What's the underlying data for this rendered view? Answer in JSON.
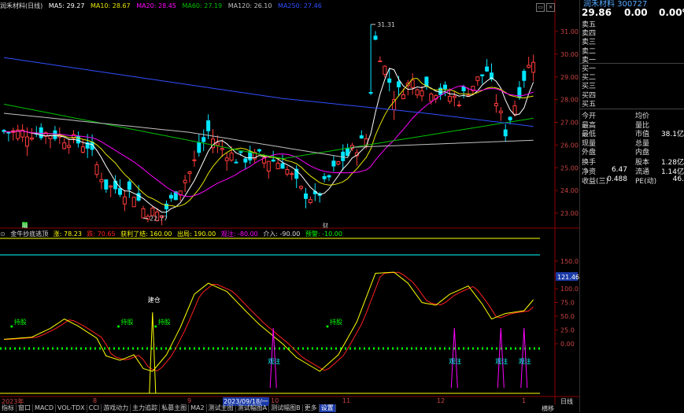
{
  "top_legend": {
    "stock": "润禾材料(日线)",
    "ma5": "MA5: 29.27",
    "ma10": "MA10: 28.67",
    "ma20": "MA20: 28.45",
    "ma60": "MA60: 27.19",
    "ma120": "MA120: 26.10",
    "ma250": "MA250: 27.46"
  },
  "price_axis": [
    "31.00",
    "30.00",
    "29.00",
    "28.00",
    "27.00",
    "26.00",
    "25.00",
    "24.00",
    "23.00"
  ],
  "price_annotations": {
    "high": "31.31",
    "low": "22.77"
  },
  "event_marks": {
    "mark1": "融",
    "mark2": "财"
  },
  "indicator_header": {
    "name": "金牛抄底逃顶",
    "zhang": "涨: 78.23",
    "die": "跌: 70.65",
    "profit": "获利了结: 160.00",
    "exit": "出局: 190.00",
    "observe": "观注: -80.00",
    "buy": "介入: -90.00",
    "watch": "预警: -10.00"
  },
  "indicator_axis": [
    "150.0",
    "125.0",
    "100.0",
    "75.0",
    "50.0",
    "25.0",
    "0.00"
  ],
  "indicator_value_badge": "121.46",
  "indicator_labels": {
    "hold1": "持股",
    "hold2": "持股",
    "hold3": "持股",
    "hold4": "持股",
    "build": "建仓",
    "note1": "观注",
    "note2": "观注",
    "note3": "观注",
    "note4": "观注"
  },
  "time_axis": [
    "2023年",
    "8",
    "9",
    "2023/09/18/一",
    "10",
    "11",
    "12",
    "1"
  ],
  "right_bottom": {
    "mode": "日线",
    "mode2": "横移"
  },
  "bottom_tabs": [
    "指标",
    "窗口",
    "MACD",
    "VOL-TDX",
    "CCI",
    "游戏动力",
    "主力追踪",
    "私募主图",
    "MA2",
    "测试主图",
    "测试幅图A",
    "测试幅图B",
    "更多",
    "设置"
  ],
  "quote": {
    "title": "润禾材料 300727",
    "price": "29.86",
    "change": "0.00",
    "change_pct": "0.00%",
    "order_labels": [
      "卖五",
      "卖四",
      "卖三",
      "卖二",
      "卖一",
      "买一",
      "买二",
      "买三",
      "买四",
      "买五"
    ],
    "stats": [
      {
        "l1": "今开",
        "v1": "",
        "l2": "均价",
        "v2": ""
      },
      {
        "l1": "最高",
        "v1": "",
        "l2": "量比",
        "v2": ""
      },
      {
        "l1": "最低",
        "v1": "",
        "l2": "市值",
        "v2": "38.1亿"
      },
      {
        "l1": "现量",
        "v1": "",
        "l2": "总量",
        "v2": ""
      },
      {
        "l1": "外盘",
        "v1": "",
        "l2": "内盘",
        "v2": ""
      },
      {
        "l1": "换手",
        "v1": "",
        "l2": "股本",
        "v2": "1.28亿"
      },
      {
        "l1": "净资",
        "v1": "6.47",
        "l2": "流通",
        "v2": "1.14亿"
      },
      {
        "l1": "收益(三)",
        "v1": "0.488",
        "l2": "PE(动)",
        "v2": "46."
      }
    ]
  },
  "colors": {
    "up": "#ff3b3b",
    "down": "#00e5ff",
    "ma5": "#ffffff",
    "ma10": "#e6e600",
    "ma20": "#ff00ff",
    "ma60": "#00c000",
    "ma120": "#c0c0c0",
    "ma250": "#2f4fff",
    "ind_yellow": "#ffff00",
    "ind_red": "#ff2020",
    "ind_green": "#00ff00",
    "ind_magenta": "#ff00ff",
    "ind_cyan": "#00ffff"
  }
}
